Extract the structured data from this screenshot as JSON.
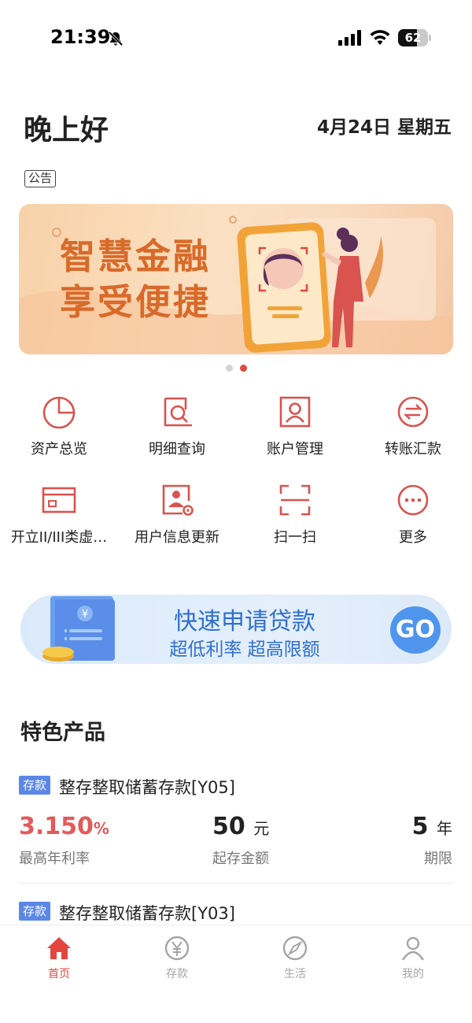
{
  "status_bar": {
    "time": "21:39",
    "battery": "62",
    "battery_level": 0.62
  },
  "header": {
    "greeting": "晚上好",
    "date": "4月24日 星期五",
    "notice_tag": "公告"
  },
  "banner": {
    "line1": "智慧金融",
    "line2": "享受便捷",
    "slide_count": 2,
    "active_slide": 2
  },
  "quick_menu": [
    {
      "label": "资产总览",
      "icon": "pie-chart-icon"
    },
    {
      "label": "明细查询",
      "icon": "document-search-icon"
    },
    {
      "label": "账户管理",
      "icon": "account-profile-icon"
    },
    {
      "label": "转账汇款",
      "icon": "transfer-icon"
    },
    {
      "label": "开立II/III类虚…",
      "icon": "card-icon"
    },
    {
      "label": "用户信息更新",
      "icon": "user-settings-icon"
    },
    {
      "label": "扫一扫",
      "icon": "scan-icon"
    },
    {
      "label": "更多",
      "icon": "more-icon"
    }
  ],
  "loan": {
    "title": "快速申请贷款",
    "subtitle": "超低利率 超高限额",
    "go_label": "GO"
  },
  "featured": {
    "title": "特色产品",
    "products": [
      {
        "tag": "存款",
        "name": "整存整取储蓄存款[Y05]",
        "rate": "3.150",
        "rate_unit": "%",
        "rate_label": "最高年利率",
        "min_amount": "50",
        "amount_unit": "元",
        "amount_label": "起存金额",
        "term": "5",
        "term_unit": "年",
        "term_label": "期限"
      },
      {
        "tag": "存款",
        "name": "整存整取储蓄存款[Y03]"
      }
    ]
  },
  "tab_bar": [
    {
      "label": "首页",
      "icon": "home-icon",
      "active": true
    },
    {
      "label": "存款",
      "icon": "yuan-icon",
      "active": false
    },
    {
      "label": "生活",
      "icon": "compass-icon",
      "active": false
    },
    {
      "label": "我的",
      "icon": "person-icon",
      "active": false
    }
  ],
  "colors": {
    "accent": "#e2473f",
    "icon_red": "#d9534f",
    "loan_blue": "#2f6fd0",
    "tag_blue": "#5b87e6",
    "rate_red": "#e45a5a"
  }
}
